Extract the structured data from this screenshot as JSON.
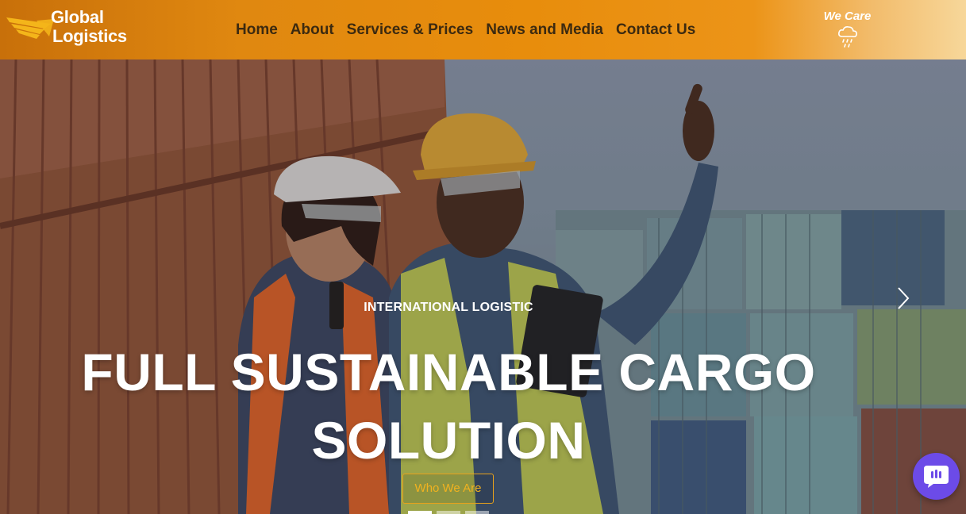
{
  "brand": {
    "line1": "Global",
    "line2": "Logistics",
    "color": "#ffffff",
    "wing_color": "#f4b51a"
  },
  "nav": {
    "items": [
      {
        "label": "Home"
      },
      {
        "label": "About"
      },
      {
        "label": "Services & Prices"
      },
      {
        "label": "News and Media"
      },
      {
        "label": "Contact Us"
      }
    ]
  },
  "wecare": {
    "label": "We Care",
    "icon": "cloud-rain-icon"
  },
  "hero": {
    "kicker": "INTERNATIONAL LOGISTIC",
    "headline": "FULL SUSTAINABLE CARGO SOLUTION",
    "cta_label": "Who We Are",
    "next_icon": "chevron-right-icon",
    "slides_count": 3,
    "active_slide": 1
  },
  "chat": {
    "icon": "chat-bubble-icon",
    "color": "#6c4be8"
  },
  "colors": {
    "header_start": "#c8700a",
    "header_end": "#f7d79a",
    "nav_text": "#3c2a10",
    "cta_accent": "#e9a11a"
  }
}
